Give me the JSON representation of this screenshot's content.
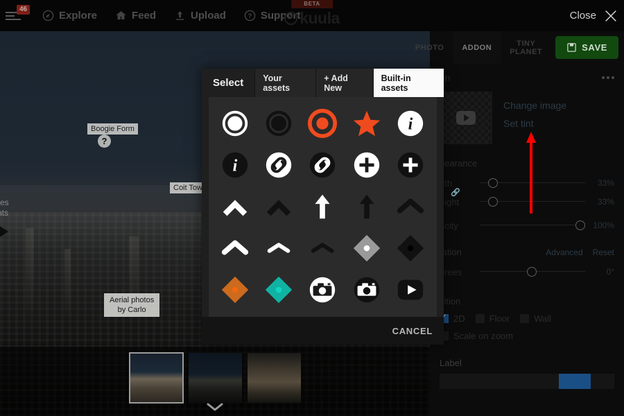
{
  "topnav": {
    "badge_count": "46",
    "items": [
      {
        "label": "Explore",
        "icon": "compass-icon"
      },
      {
        "label": "Feed",
        "icon": "home-icon"
      },
      {
        "label": "Upload",
        "icon": "upload-icon"
      },
      {
        "label": "Support",
        "icon": "question-circle-icon"
      }
    ],
    "logo": {
      "beta": "BETA",
      "name": "kuula"
    },
    "close_label": "Close"
  },
  "viewer": {
    "hotspots": [
      {
        "label": "Boogie Form",
        "marker": "?"
      },
      {
        "label": "Coit Tower"
      }
    ],
    "credit_line1": "Aerial photos",
    "credit_line2": "by Carlo",
    "partial_text_line1": "res",
    "partial_text_line2": "nts",
    "thumbnails": [
      {
        "name": "thumbnail-1",
        "selected": true
      },
      {
        "name": "thumbnail-2",
        "selected": false
      },
      {
        "name": "thumbnail-3",
        "selected": false
      }
    ]
  },
  "editor": {
    "tabs": [
      {
        "label": "PHOTO",
        "active": false
      },
      {
        "label": "ADDON",
        "active": true
      },
      {
        "label": "TINY\nPLANET",
        "active": false
      }
    ],
    "tab_photo": "PHOTO",
    "tab_addon": "ADDON",
    "tab_tiny_line1": "TINY",
    "tab_tiny_line2": "PLANET",
    "save_label": "SAVE",
    "panel_title": "on",
    "change_image": "Change image",
    "set_tint": "Set tint",
    "appearance_title": "pearance",
    "width_label": "dth",
    "width_value": "33%",
    "height_label": "eight",
    "height_value": "33%",
    "opacity_label": "acity",
    "opacity_value": "100%",
    "orientation_title": "tation",
    "advanced_label": "Advanced",
    "reset_label": "Reset",
    "degrees_label": "grees",
    "degrees_value": "0°",
    "position_title": "sition",
    "check_2d": "2D",
    "check_floor": "Floor",
    "check_wall": "Wall",
    "scale_on_zoom": "Scale on zoom",
    "label_title": "Label"
  },
  "modal": {
    "title": "Select",
    "tabs": [
      {
        "label": "Your assets",
        "active": false
      },
      {
        "label": "+ Add New",
        "active": false
      },
      {
        "label": "Built-in assets",
        "active": true
      }
    ],
    "cancel_label": "CANCEL",
    "assets": [
      {
        "name": "ring-white-icon",
        "shape": "ring",
        "fg": "#ffffff",
        "bg": "none"
      },
      {
        "name": "ring-black-icon",
        "shape": "ring",
        "fg": "#111111",
        "bg": "none"
      },
      {
        "name": "ring-orange-icon",
        "shape": "ring",
        "fg": "#f04b1e",
        "bg": "none"
      },
      {
        "name": "star-orange-icon",
        "shape": "star",
        "fg": "#f04b1e",
        "bg": "none"
      },
      {
        "name": "info-white-icon",
        "shape": "info",
        "fg": "#ffffff",
        "bg": "#ffffff"
      },
      {
        "name": "info-black-icon",
        "shape": "info",
        "fg": "#111111",
        "bg": "#111111"
      },
      {
        "name": "link-white-icon",
        "shape": "link",
        "fg": "#ffffff",
        "bg": "#ffffff"
      },
      {
        "name": "link-black-icon",
        "shape": "link",
        "fg": "#111111",
        "bg": "#111111"
      },
      {
        "name": "plus-white-icon",
        "shape": "plus",
        "fg": "#ffffff",
        "bg": "#ffffff"
      },
      {
        "name": "plus-black-icon",
        "shape": "plus",
        "fg": "#111111",
        "bg": "#111111"
      },
      {
        "name": "chevron-up-white-thick-icon",
        "shape": "chev-thick",
        "fg": "#ffffff",
        "bg": "none"
      },
      {
        "name": "chevron-up-black-thick-icon",
        "shape": "chev-thick",
        "fg": "#111111",
        "bg": "none"
      },
      {
        "name": "arrow-up-white-icon",
        "shape": "arrow",
        "fg": "#ffffff",
        "bg": "none"
      },
      {
        "name": "arrow-up-black-icon",
        "shape": "arrow",
        "fg": "#111111",
        "bg": "none"
      },
      {
        "name": "chevron-up-black-round-icon",
        "shape": "chev-round",
        "fg": "#111111",
        "bg": "none"
      },
      {
        "name": "chevron-up-white-round-icon",
        "shape": "chev-round",
        "fg": "#ffffff",
        "bg": "none"
      },
      {
        "name": "chevron-up-white-thin-icon",
        "shape": "chev-thin",
        "fg": "#ffffff",
        "bg": "none"
      },
      {
        "name": "chevron-up-black-thin-icon",
        "shape": "chev-thin",
        "fg": "#111111",
        "bg": "none"
      },
      {
        "name": "diamond-gray-icon",
        "shape": "diamond",
        "fg": "#9a9a9a",
        "bg": "none"
      },
      {
        "name": "diamond-black-icon",
        "shape": "diamond",
        "fg": "#111111",
        "bg": "none"
      },
      {
        "name": "diamond-orange-icon",
        "shape": "diamond",
        "fg": "#cc6a1e",
        "bg": "none"
      },
      {
        "name": "diamond-teal-icon",
        "shape": "diamond",
        "fg": "#10b3a3",
        "bg": "none"
      },
      {
        "name": "camera-white-icon",
        "shape": "camera",
        "fg": "#ffffff",
        "bg": "#ffffff"
      },
      {
        "name": "camera-black-icon",
        "shape": "camera",
        "fg": "#111111",
        "bg": "#111111"
      },
      {
        "name": "play-black-icon",
        "shape": "play",
        "fg": "#111111",
        "bg": "#111111"
      },
      {
        "name": "partial-white-1-icon",
        "shape": "partial",
        "fg": "#ffffff",
        "bg": "none"
      },
      {
        "name": "partial-black-1-icon",
        "shape": "partial",
        "fg": "#111111",
        "bg": "none"
      },
      {
        "name": "partial-white-2-icon",
        "shape": "partial",
        "fg": "#ffffff",
        "bg": "none"
      },
      {
        "name": "partial-black-2-icon",
        "shape": "partial",
        "fg": "#222222",
        "bg": "none"
      },
      {
        "name": "partial-white-3-icon",
        "shape": "partial",
        "fg": "#ffffff",
        "bg": "none"
      }
    ]
  },
  "colors": {
    "accent_orange": "#f04b1e",
    "save_green": "#12490f",
    "annotation_red": "#ff0000",
    "badge_red": "#7c2018",
    "link_blue": "#2c3b47"
  }
}
